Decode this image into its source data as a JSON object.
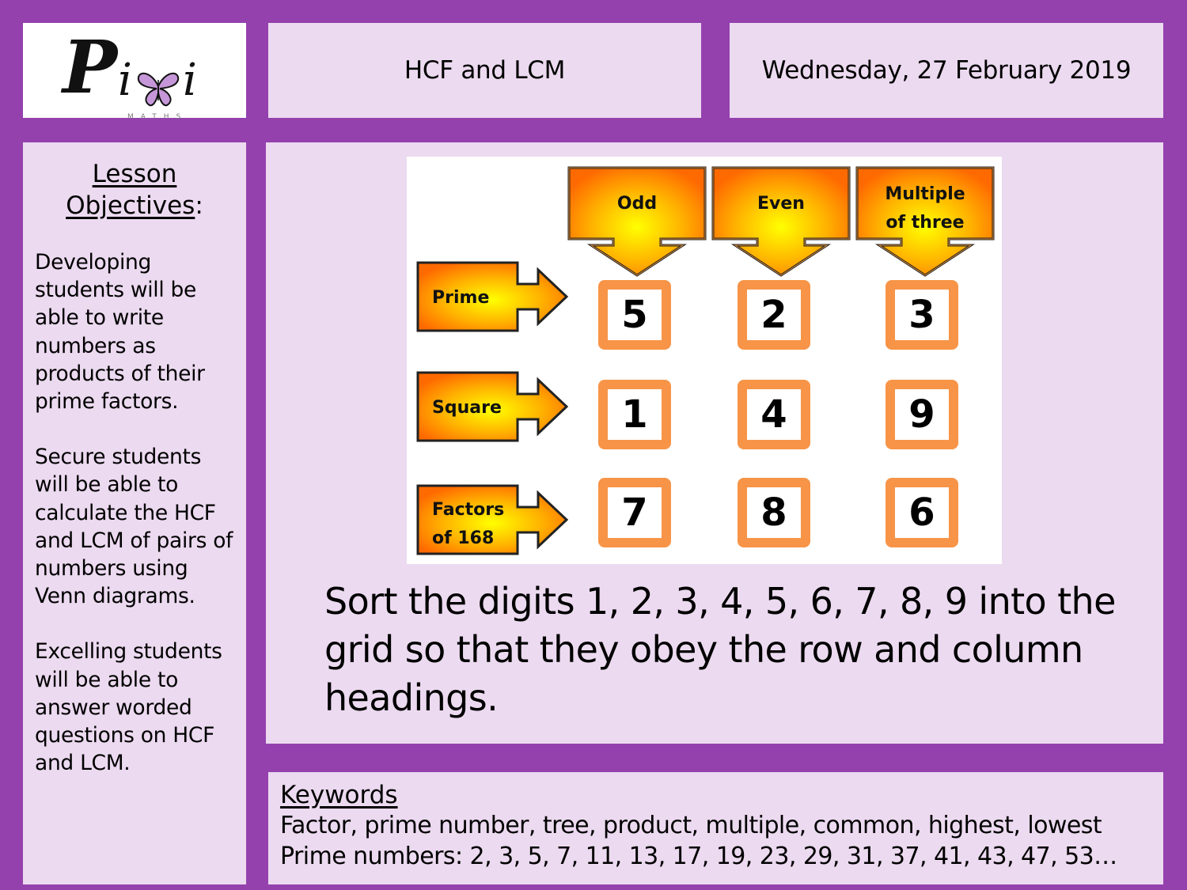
{
  "logo": {
    "brand": "Pixi",
    "brand_parts": [
      "P",
      "i",
      "i"
    ],
    "subtitle": "MATHS",
    "butterfly_color": "#c597d8"
  },
  "header": {
    "title": "HCF and LCM",
    "date": "Wednesday, 27 February 2019"
  },
  "objectives": {
    "title_line1": "Lesson",
    "title_line2": "Objectives",
    "title_suffix": ":",
    "items": [
      "Developing students will be able to write numbers as products of their prime factors.",
      "Secure students will be able to calculate the HCF and LCM of pairs of numbers using Venn diagrams.",
      "Excelling students will be able to answer worded questions on HCF and LCM."
    ]
  },
  "puzzle": {
    "columns": [
      {
        "lines": [
          "Odd"
        ]
      },
      {
        "lines": [
          "Even"
        ]
      },
      {
        "lines": [
          "Multiple",
          "of three"
        ]
      }
    ],
    "rows": [
      {
        "lines": [
          "Prime"
        ]
      },
      {
        "lines": [
          "Square"
        ]
      },
      {
        "lines": [
          "Factors",
          "of 168"
        ]
      }
    ],
    "grid": [
      [
        "5",
        "2",
        "3"
      ],
      [
        "1",
        "4",
        "9"
      ],
      [
        "7",
        "8",
        "6"
      ]
    ],
    "colors": {
      "arrow_outer": "#ff6a00",
      "arrow_inner": "#ffff00",
      "cell_border": "#f79447"
    }
  },
  "instruction": "Sort the digits 1, 2, 3, 4, 5, 6, 7, 8, 9 into the grid so that they obey the row and column headings.",
  "keywords": {
    "title": "Keywords",
    "line1": "Factor, prime number, tree, product, multiple, common, highest, lowest",
    "line2": "Prime numbers: 2, 3, 5, 7, 11, 13, 17, 19, 23, 29, 31, 37, 41, 43, 47, 53…"
  },
  "theme": {
    "frame": "#9441ae",
    "panel": "#ecdaf0"
  }
}
